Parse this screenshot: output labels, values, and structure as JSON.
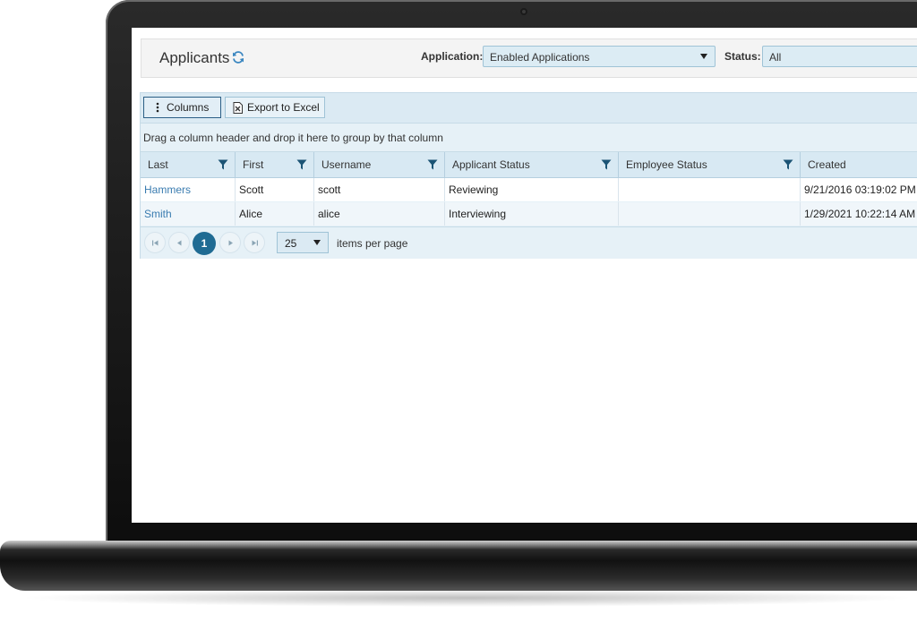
{
  "header": {
    "title": "Applicants",
    "application_label": "Application:",
    "application_value": "Enabled Applications",
    "status_label": "Status:",
    "status_value": "All"
  },
  "toolbar": {
    "columns_label": "Columns",
    "export_label": "Export to Excel"
  },
  "group_hint": "Drag a column header and drop it here to group by that column",
  "columns": [
    "Last",
    "First",
    "Username",
    "Applicant Status",
    "Employee Status",
    "Created"
  ],
  "rows": [
    [
      "Hammers",
      "Scott",
      "scott",
      "Reviewing",
      "",
      "9/21/2016 03:19:02 PM"
    ],
    [
      "Smith",
      "Alice",
      "alice",
      "Interviewing",
      "",
      "1/29/2021 10:22:14 AM"
    ]
  ],
  "pager": {
    "current_page": "1",
    "page_size": "25",
    "items_per_page_label": "items per page"
  },
  "colors": {
    "accent": "#1f6b93",
    "link": "#3a7cb0"
  }
}
